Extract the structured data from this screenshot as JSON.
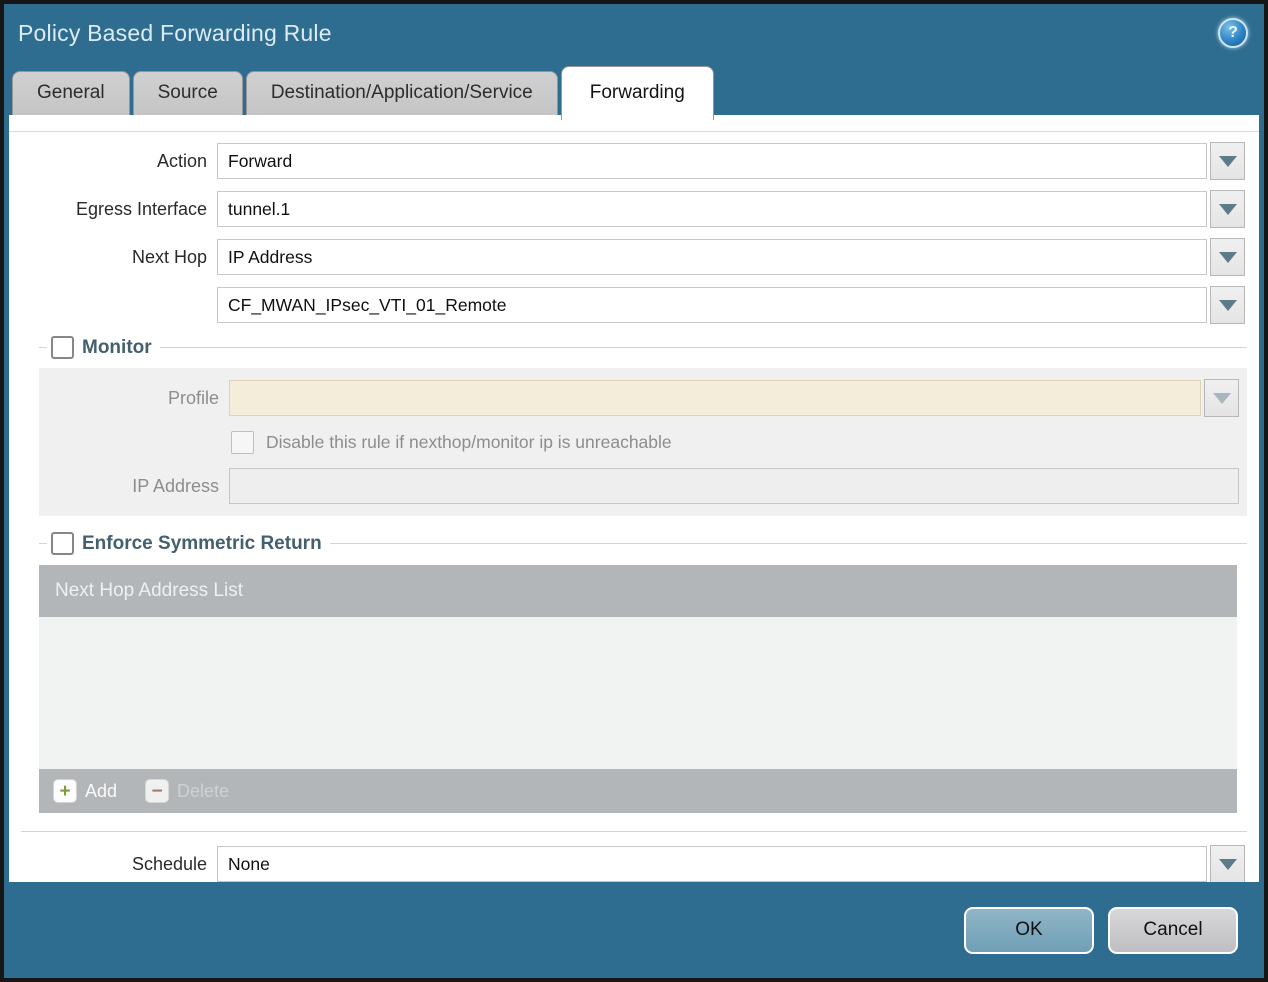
{
  "dialog": {
    "title": "Policy Based Forwarding Rule"
  },
  "icons": {
    "help": "?",
    "add": "+",
    "delete": "−",
    "chevron": "▼"
  },
  "tabs": [
    {
      "label": "General",
      "active": false
    },
    {
      "label": "Source",
      "active": false
    },
    {
      "label": "Destination/Application/Service",
      "active": false
    },
    {
      "label": "Forwarding",
      "active": true
    }
  ],
  "form": {
    "action": {
      "label": "Action",
      "value": "Forward"
    },
    "egress_interface": {
      "label": "Egress Interface",
      "value": "tunnel.1"
    },
    "next_hop": {
      "label": "Next Hop",
      "value": "IP Address"
    },
    "next_hop_address": {
      "value": "CF_MWAN_IPsec_VTI_01_Remote"
    },
    "schedule": {
      "label": "Schedule",
      "value": "None"
    }
  },
  "monitor": {
    "legend": "Monitor",
    "checked": false,
    "profile_label": "Profile",
    "profile_value": "",
    "disable_rule_label": "Disable this rule if nexthop/monitor ip is unreachable",
    "disable_rule_checked": false,
    "ip_address_label": "IP Address",
    "ip_address_value": ""
  },
  "symmetric_return": {
    "legend": "Enforce Symmetric Return",
    "checked": false,
    "table_header": "Next Hop Address List",
    "rows": [],
    "add_label": "Add",
    "delete_label": "Delete"
  },
  "footer": {
    "ok_label": "OK",
    "cancel_label": "Cancel"
  },
  "colors": {
    "titlebar_teal": "#2e6d90",
    "legend_text": "#44606e",
    "disabled_field_cream": "#f3edda",
    "table_gray": "#b3b6b9",
    "add_green": "#7e9b3e",
    "delete_red": "#a9746b",
    "ok_button": "#7ca7bd",
    "cancel_button": "#c9cacd"
  }
}
